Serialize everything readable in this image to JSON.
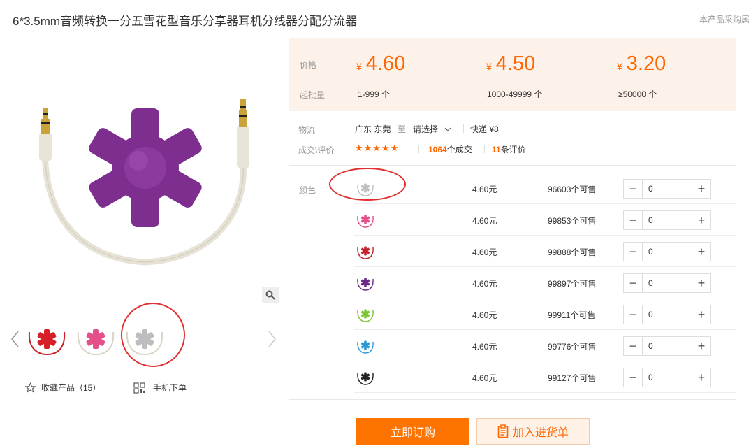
{
  "product": {
    "title": "6*3.5mm音频转换一分五雪花型音乐分享器耳机分线器分配分流器",
    "side_note": "本产品采购属"
  },
  "gallery": {
    "main_image": "purple-snowflake-audio-splitter",
    "thumbnails": [
      "red-splitter",
      "pink-splitter",
      "white-splitter"
    ],
    "favorite_label": "收藏产品（15）",
    "mobile_order_label": "手机下单"
  },
  "pricing": {
    "price_label": "价格",
    "moq_label": "起批量",
    "currency": "¥",
    "tiers": [
      {
        "price": "4.60",
        "range": "1-999 个"
      },
      {
        "price": "4.50",
        "range": "1000-49999 个"
      },
      {
        "price": "3.20",
        "range": "≥50000 个"
      }
    ]
  },
  "logistics": {
    "label": "物流",
    "origin": "广东 东莞",
    "to": "至",
    "destination": "请选择",
    "shipping": "快递 ¥8"
  },
  "reviews": {
    "label": "成交\\评价",
    "stars": "★★★★★",
    "deals_count": "1064",
    "deals_suffix": "个成交",
    "review_count": "11",
    "review_suffix": "条评价"
  },
  "variants": {
    "label": "颜色",
    "rows": [
      {
        "color": "#bfbfbf",
        "price": "4.60元",
        "stock": "96603个可售",
        "qty": "0"
      },
      {
        "color": "#e6508a",
        "price": "4.60元",
        "stock": "99853个可售",
        "qty": "0"
      },
      {
        "color": "#c8202a",
        "price": "4.60元",
        "stock": "99888个可售",
        "qty": "0"
      },
      {
        "color": "#6a2a8a",
        "price": "4.60元",
        "stock": "99897个可售",
        "qty": "0"
      },
      {
        "color": "#7cc432",
        "price": "4.60元",
        "stock": "99911个可售",
        "qty": "0"
      },
      {
        "color": "#2a9ad4",
        "price": "4.60元",
        "stock": "99776个可售",
        "qty": "0"
      },
      {
        "color": "#222222",
        "price": "4.60元",
        "stock": "99127个可售",
        "qty": "0"
      }
    ]
  },
  "actions": {
    "buy_now": "立即订购",
    "add_to_cart": "加入进货单"
  }
}
